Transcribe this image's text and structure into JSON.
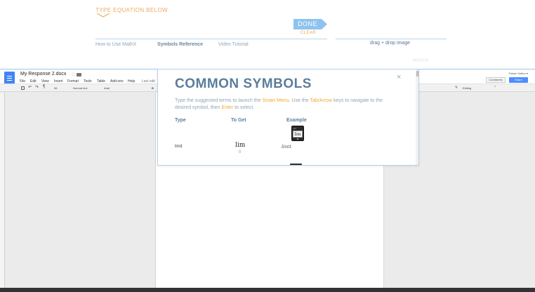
{
  "mathx": {
    "prompt_label": "TYPE EQUATION BELOW",
    "done_label": "DONE",
    "clear_label": "CLEAR",
    "tabs": [
      {
        "label": "How to Use MathX"
      },
      {
        "label": "Symbols Reference"
      },
      {
        "label": "Video Tutorial"
      }
    ],
    "drag_drop_label": "drag + drop image",
    "brand": "MATHX"
  },
  "docs": {
    "title": "My Response 2.docx",
    "user": "Tristan Sutton ▾",
    "comments_label": "Comments",
    "share_label": "Share",
    "menu": [
      "File",
      "Edit",
      "View",
      "Insert",
      "Format",
      "Tools",
      "Table",
      "Add-ons",
      "Help",
      "Last edit"
    ],
    "toolbar": {
      "zoom": "96",
      "style": "Normal text",
      "font": "Arial",
      "bold": "B",
      "editing": "Editing"
    }
  },
  "popup": {
    "heading": "COMMON SYMBOLS",
    "instr_1": "Type the suggested terms to launch the ",
    "instr_smart_menu": "Smart Menu",
    "instr_2": ". Use the ",
    "instr_tab_arrow": "Tab/Arrow",
    "instr_3": " keys to navigate to the desired symbol, then ",
    "instr_enter": "Enter",
    "instr_4": " to select.",
    "columns": {
      "type": "Type",
      "to_get": "To Get",
      "example": "Example"
    },
    "key_top": "lim",
    "key_symbol": "lim",
    "row": {
      "type": "limit",
      "to_get": "lim",
      "to_get_sub": "0",
      "example": "limit"
    }
  },
  "colors": {
    "accent_orange": "#f0a860",
    "done_blue": "#8ec3ef",
    "heading_blue": "#5c7d9c",
    "docs_blue": "#4285f4",
    "highlight_yellow": "#f2a833"
  }
}
